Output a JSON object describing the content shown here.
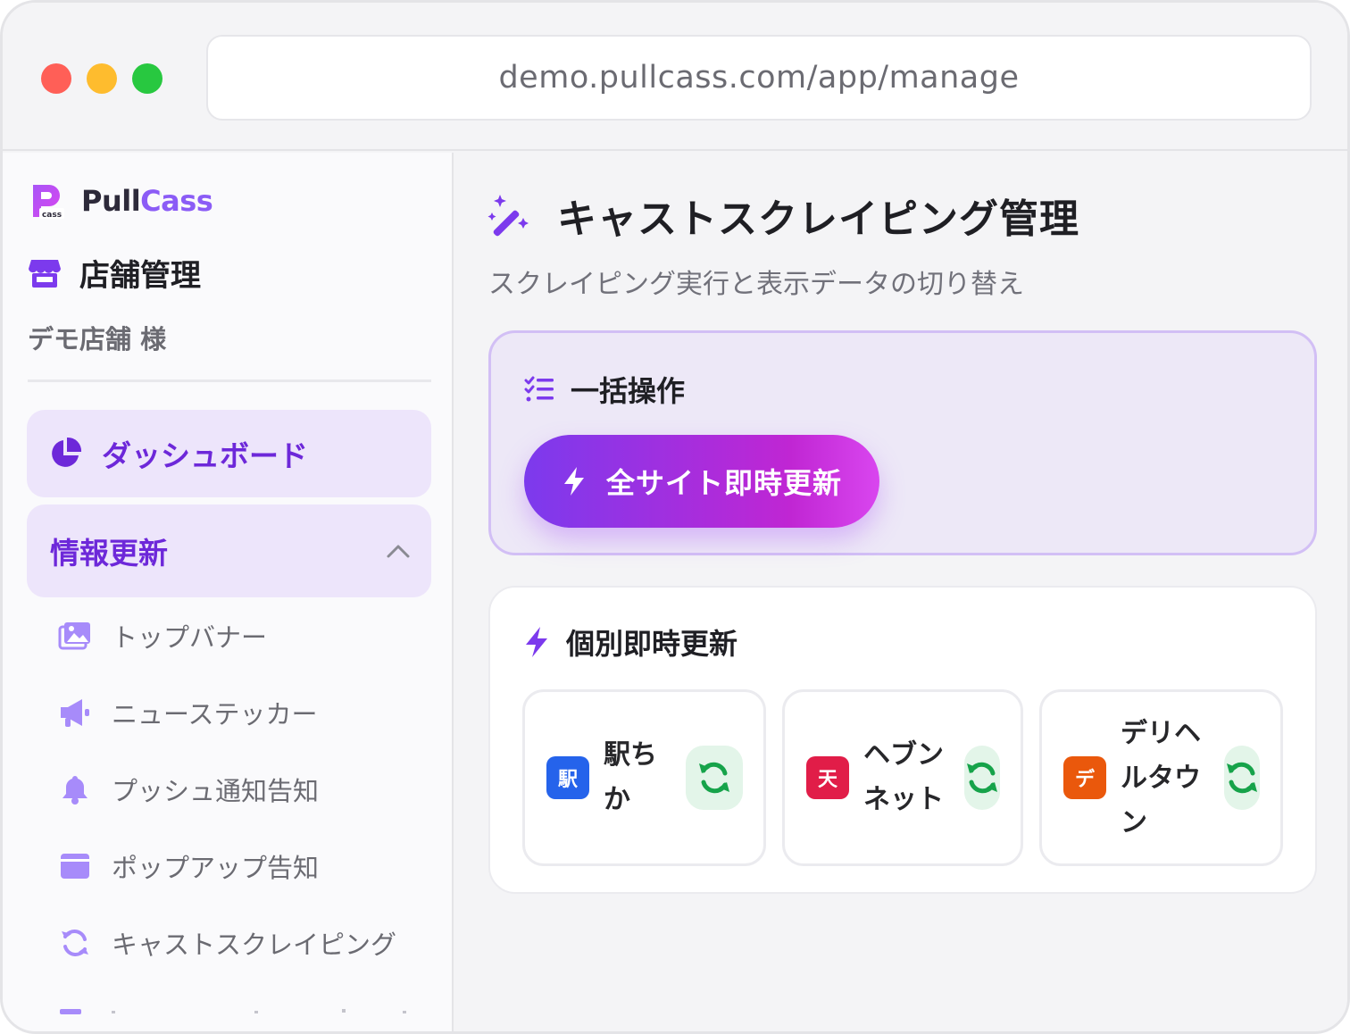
{
  "browser": {
    "url": "demo.pullcass.com/app/manage"
  },
  "sidebar": {
    "logo": {
      "text_pull": "Pull",
      "text_cass": "Cass",
      "mark_text": "cass"
    },
    "store_title": "店舗管理",
    "store_name": "デモ店舗 様",
    "nav": {
      "dashboard": "ダッシュボード",
      "info_update": "情報更新"
    },
    "subnav": [
      {
        "label": "トップバナー",
        "icon": "images-icon"
      },
      {
        "label": "ニューステッカー",
        "icon": "megaphone-icon"
      },
      {
        "label": "プッシュ通知告知",
        "icon": "bell-icon"
      },
      {
        "label": "ポップアップ告知",
        "icon": "window-icon"
      },
      {
        "label": "キャストスクレイピング",
        "icon": "sync-icon"
      }
    ]
  },
  "main": {
    "title": "キャストスクレイピング管理",
    "subtitle": "スクレイピング実行と表示データの切り替え",
    "bulk": {
      "heading": "一括操作",
      "button_label": "全サイト即時更新"
    },
    "individual": {
      "heading": "個別即時更新",
      "sites": [
        {
          "badge": "駅",
          "name_line1": "駅ち",
          "name_line2": "か",
          "name_line3": "",
          "badge_color": "#2563eb"
        },
        {
          "badge": "天",
          "name_line1": "ヘブン",
          "name_line2": "ネット",
          "name_line3": "",
          "badge_color": "#e11d48"
        },
        {
          "badge": "デ",
          "name_line1": "デリヘ",
          "name_line2": "ルタウ",
          "name_line3": "ン",
          "badge_color": "#ea580c"
        }
      ]
    }
  },
  "colors": {
    "accent": "#7c3aed",
    "accent_light": "#ede5fb",
    "refresh_green": "#16a34a"
  }
}
